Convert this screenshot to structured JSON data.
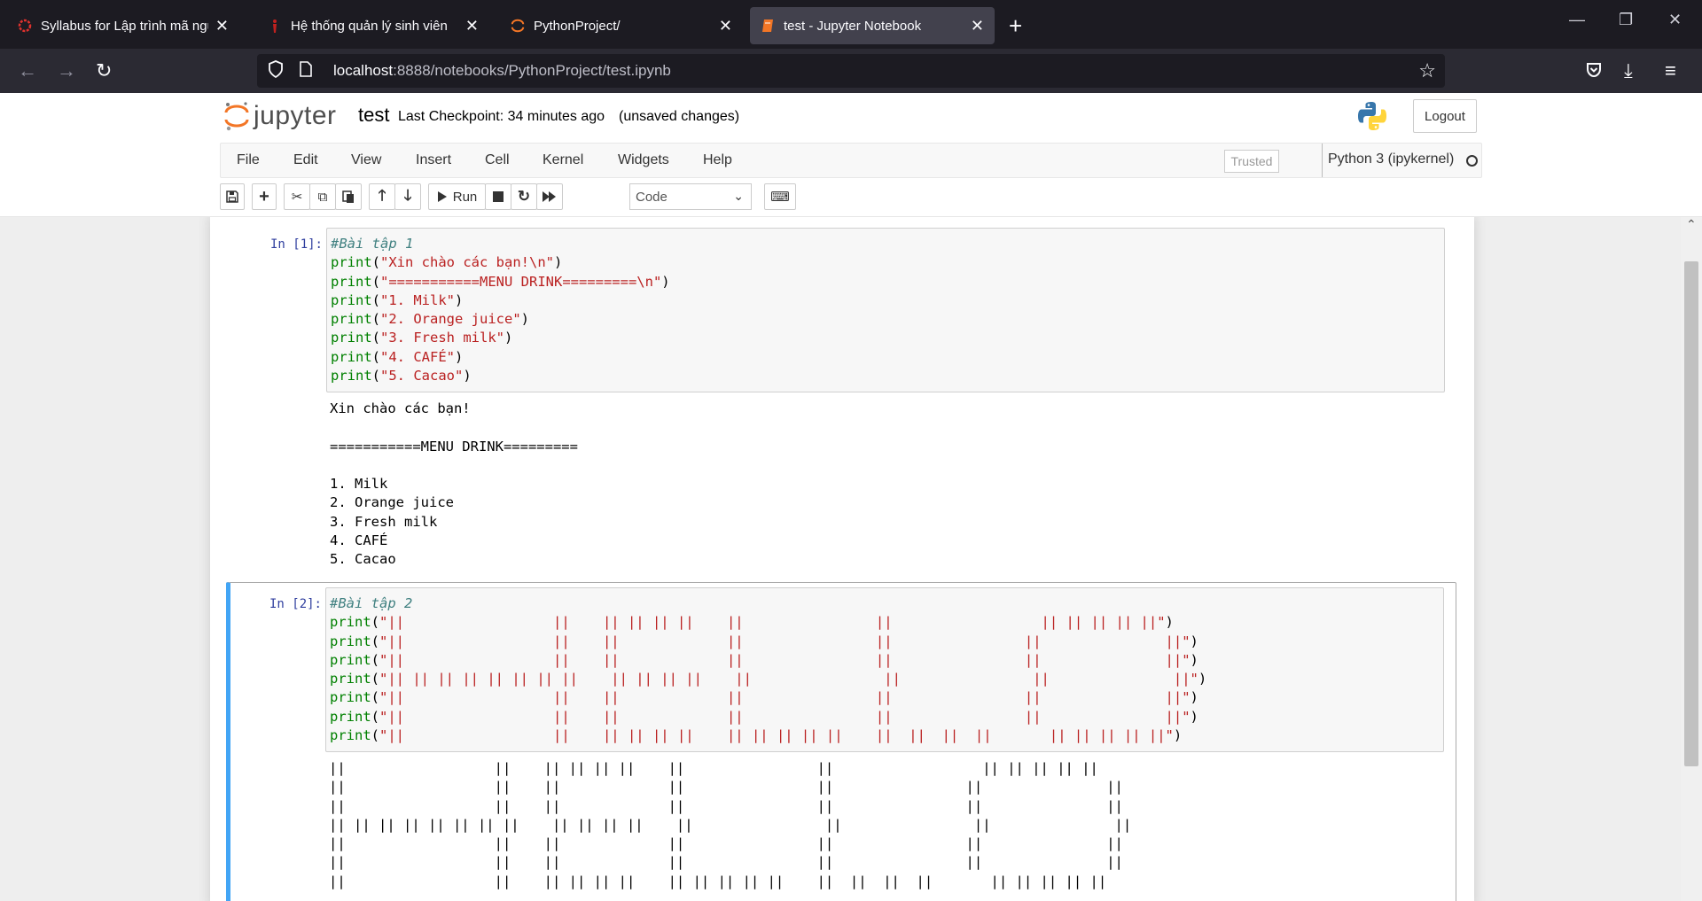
{
  "browser": {
    "tabs": [
      {
        "title": "Syllabus for Lập trình mã nguồn",
        "icon": "red-ring-icon"
      },
      {
        "title": "Hệ thống quản lý sinh viên",
        "icon": "red-figure-icon"
      },
      {
        "title": "PythonProject/",
        "icon": "jupyter-icon"
      },
      {
        "title": "test - Jupyter Notebook",
        "icon": "notebook-icon"
      }
    ],
    "active_tab": 3,
    "url_host": "localhost",
    "url_path": ":8888/notebooks/PythonProject/test.ipynb"
  },
  "jupyter": {
    "logo_text": "jupyter",
    "notebook_name": "test",
    "checkpoint": "Last Checkpoint: 34 minutes ago",
    "unsaved": "(unsaved changes)",
    "logout_label": "Logout",
    "menu": [
      "File",
      "Edit",
      "View",
      "Insert",
      "Cell",
      "Kernel",
      "Widgets",
      "Help"
    ],
    "trusted_label": "Trusted",
    "kernel_name": "Python 3 (ipykernel)",
    "run_label": "Run",
    "cell_type": "Code"
  },
  "cells": [
    {
      "prompt": "In [1]:",
      "source": [
        "#Bài tập 1",
        "print(\"Xin chào các bạn!\\n\")",
        "print(\"===========MENU DRINK=========\\n\")",
        "print(\"1. Milk\")",
        "print(\"2. Orange juice\")",
        "print(\"3. Fresh milk\")",
        "print(\"4. CAFÉ\")",
        "print(\"5. Cacao\")"
      ],
      "output": [
        "Xin chào các bạn!",
        "",
        "===========MENU DRINK=========",
        "",
        "1. Milk",
        "2. Orange juice",
        "3. Fresh milk",
        "4. CAFÉ",
        "5. Cacao"
      ]
    },
    {
      "prompt": "In [2]:",
      "source": [
        "#Bài tập 2",
        "print(\"||                  ||    || || || ||    ||                ||                  || || || || ||\")",
        "print(\"||                  ||    ||             ||                ||                ||               ||\")",
        "print(\"||                  ||    ||             ||                ||                ||               ||\")",
        "print(\"|| || || || || || || ||    || || || ||    ||                ||                ||               ||\")",
        "print(\"||                  ||    ||             ||                ||                ||               ||\")",
        "print(\"||                  ||    ||             ||                ||                ||               ||\")",
        "print(\"||                  ||    || || || ||    || || || || ||    ||  ||  ||  ||       || || || || ||\")"
      ],
      "output": [
        "||                  ||    || || || ||    ||                ||                  || || || || ||",
        "||                  ||    ||             ||                ||                ||               ||",
        "||                  ||    ||             ||                ||                ||               ||",
        "|| || || || || || || ||    || || || ||    ||                ||                ||               ||",
        "||                  ||    ||             ||                ||                ||               ||",
        "||                  ||    ||             ||                ||                ||               ||",
        "||                  ||    || || || ||    || || || || ||    ||  ||  ||  ||       || || || || ||"
      ]
    }
  ],
  "colors": {
    "selected_border": "#42a5f5",
    "prompt": "#303f9f",
    "comment": "#408080",
    "builtin": "#008000",
    "string": "#ba2121"
  }
}
